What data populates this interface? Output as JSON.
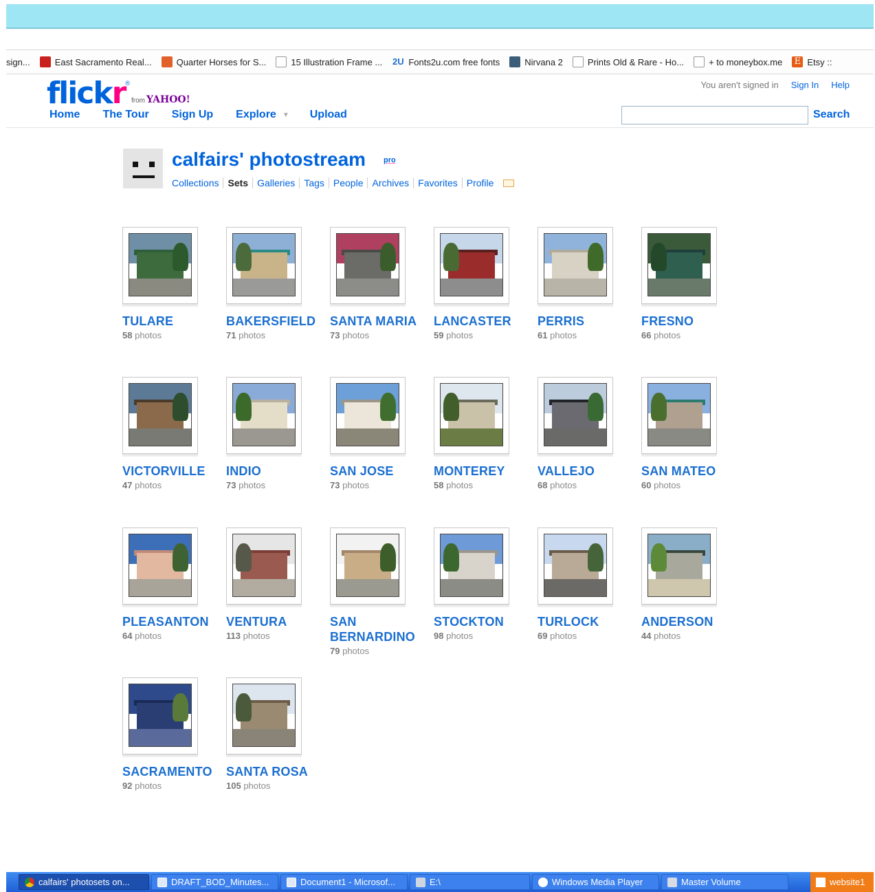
{
  "bookmarks": [
    {
      "label": "sign...",
      "icon": "none"
    },
    {
      "label": "East Sacramento Real...",
      "icon": "sale-icon"
    },
    {
      "label": "Quarter Horses for S...",
      "icon": "horse-icon"
    },
    {
      "label": "15 Illustration Frame ...",
      "icon": "page-icon"
    },
    {
      "label": "Fonts2u.com free fonts",
      "icon": "fonts2u-icon"
    },
    {
      "label": "Nirvana 2",
      "icon": "nirvana-icon"
    },
    {
      "label": "Prints Old & Rare - Ho...",
      "icon": "page-icon"
    },
    {
      "label": "+ to moneybox.me",
      "icon": "page-icon"
    },
    {
      "label": "Etsy ::",
      "icon": "etsy-icon"
    }
  ],
  "header": {
    "logo_flick": "flick",
    "logo_r": "r",
    "logo_from": "from",
    "logo_yahoo": "YAHOO!",
    "signed_out_text": "You aren't signed in",
    "sign_in": "Sign In",
    "help": "Help",
    "nav": {
      "home": "Home",
      "tour": "The Tour",
      "signup": "Sign Up",
      "explore": "Explore",
      "upload": "Upload"
    },
    "search_button": "Search",
    "search_value": ""
  },
  "profile": {
    "title": "calfairs' photostream",
    "pro_badge": "pro",
    "subnav": [
      "Collections",
      "Sets",
      "Galleries",
      "Tags",
      "People",
      "Archives",
      "Favorites",
      "Profile"
    ],
    "active_tab": "Sets"
  },
  "sets": [
    {
      "title": "TULARE",
      "count": "58",
      "unit": "photos"
    },
    {
      "title": "BAKERSFIELD",
      "count": "71",
      "unit": "photos"
    },
    {
      "title": "SANTA MARIA",
      "count": "73",
      "unit": "photos"
    },
    {
      "title": "LANCASTER",
      "count": "59",
      "unit": "photos"
    },
    {
      "title": "PERRIS",
      "count": "61",
      "unit": "photos"
    },
    {
      "title": "FRESNO",
      "count": "66",
      "unit": "photos"
    },
    {
      "title": "VICTORVILLE",
      "count": "47",
      "unit": "photos"
    },
    {
      "title": "INDIO",
      "count": "73",
      "unit": "photos"
    },
    {
      "title": "SAN JOSE",
      "count": "73",
      "unit": "photos"
    },
    {
      "title": "MONTEREY",
      "count": "58",
      "unit": "photos"
    },
    {
      "title": "VALLEJO",
      "count": "68",
      "unit": "photos"
    },
    {
      "title": "SAN MATEO",
      "count": "60",
      "unit": "photos"
    },
    {
      "title": "PLEASANTON",
      "count": "64",
      "unit": "photos"
    },
    {
      "title": "VENTURA",
      "count": "113",
      "unit": "photos"
    },
    {
      "title": "SAN BERNARDINO",
      "count": "79",
      "unit": "photos"
    },
    {
      "title": "STOCKTON",
      "count": "98",
      "unit": "photos"
    },
    {
      "title": "TURLOCK",
      "count": "69",
      "unit": "photos"
    },
    {
      "title": "ANDERSON",
      "count": "44",
      "unit": "photos"
    },
    {
      "title": "SACRAMENTO",
      "count": "92",
      "unit": "photos"
    },
    {
      "title": "SANTA ROSA",
      "count": "105",
      "unit": "photos"
    }
  ],
  "taskbar": [
    {
      "label": "calfairs' photosets on...",
      "icon": "chrome-icon",
      "active": true
    },
    {
      "label": "DRAFT_BOD_Minutes...",
      "icon": "word-doc-icon",
      "active": false
    },
    {
      "label": "Document1 - Microsof...",
      "icon": "word-doc-icon",
      "active": false
    },
    {
      "label": "E:\\",
      "icon": "drive-icon",
      "active": false
    },
    {
      "label": "Windows Media Player",
      "icon": "media-player-icon",
      "active": false
    },
    {
      "label": "Master Volume",
      "icon": "volume-icon",
      "active": false
    }
  ],
  "tray_label": "website1",
  "colors": {
    "flickr_blue": "#0063dc",
    "flickr_pink": "#ff0084",
    "set_title": "#1b6fd0",
    "chrome_band": "#9ee6f4",
    "taskbar": "#1f5fd6"
  }
}
